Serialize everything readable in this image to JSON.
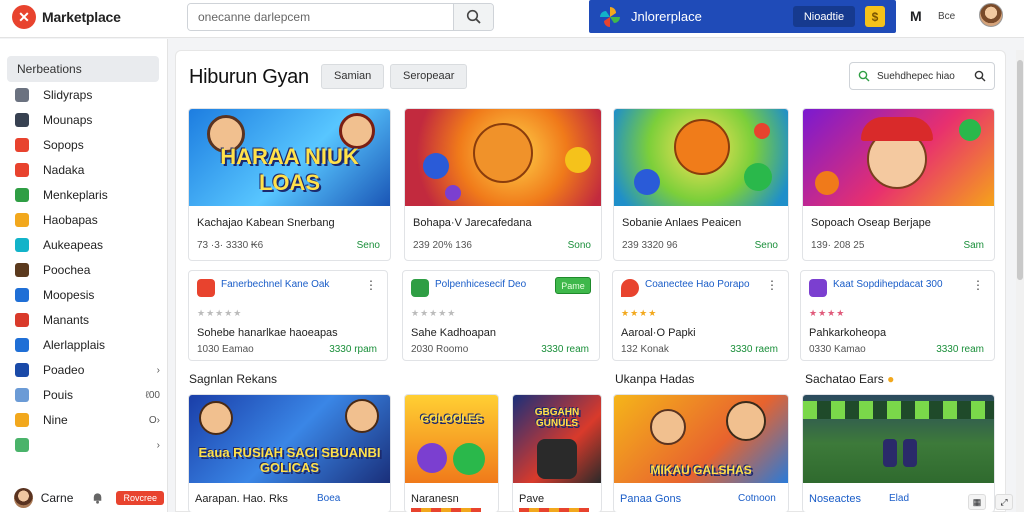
{
  "app": {
    "name": "Marketplace"
  },
  "search": {
    "placeholder": "onecanne darlepcem"
  },
  "promo": {
    "title": "Jnlorerplace",
    "button": "Nioadtie",
    "coin": "$"
  },
  "header": {
    "m_label": "M",
    "user_label": "Bce"
  },
  "sidebar": {
    "header": "Nerbeations",
    "items": [
      {
        "label": "Slidyraps",
        "icon_color": "#6b7280",
        "meta": ""
      },
      {
        "label": "Mounaps",
        "icon_color": "#374151",
        "meta": ""
      },
      {
        "label": "Sopops",
        "icon_color": "#e8432e",
        "meta": ""
      },
      {
        "label": "Nadaka",
        "icon_color": "#e8432e",
        "meta": ""
      },
      {
        "label": "Menkeplaris",
        "icon_color": "#2f9e44",
        "meta": ""
      },
      {
        "label": "Haobapas",
        "icon_color": "#f2a81d",
        "meta": ""
      },
      {
        "label": "Aukeapeas",
        "icon_color": "#12b3c9",
        "meta": ""
      },
      {
        "label": "Poochea",
        "icon_color": "#5b3a1e",
        "meta": ""
      },
      {
        "label": "Moopesis",
        "icon_color": "#1f6fd6",
        "meta": ""
      },
      {
        "label": "Manants",
        "icon_color": "#d93a2b",
        "meta": ""
      },
      {
        "label": "Alerlapplais",
        "icon_color": "#1f6fd6",
        "meta": ""
      },
      {
        "label": "Poadeo",
        "icon_color": "#1a4aa8",
        "meta": "›"
      },
      {
        "label": "Pouis",
        "icon_color": "#6b9bd6",
        "meta": "ℓ00"
      },
      {
        "label": "Nine",
        "icon_color": "#f2a81d",
        "meta": "O›"
      },
      {
        "label": "",
        "icon_color": "#4ab36a",
        "meta": "›"
      }
    ],
    "user": {
      "name": "Carne",
      "badge": "Rovcree"
    }
  },
  "main": {
    "title": "Hiburun Gyan",
    "filters": [
      "Samian",
      "Seropeaar"
    ],
    "search_label": "Suehdhepec hiao"
  },
  "featured": [
    {
      "art_text": "HARAA NIUK LOAS",
      "name": "Kachajao Kabean Snerbang",
      "meta": "73 ·3· 3330 ₭6",
      "price": "Seno"
    },
    {
      "art_text": "",
      "name": "Bohapa·V Jarecafedana",
      "meta": "239 20% 136",
      "price": "Sono"
    },
    {
      "art_text": "",
      "name": "Sobanie Anlaes Peaicen",
      "meta": "239 3320 96",
      "price": "Seno"
    },
    {
      "art_text": "",
      "name": "Sopoach Oseap Berjape",
      "meta": "139· 208 25",
      "price": "Sam"
    }
  ],
  "listings": [
    {
      "title": "Fanerbechnel Kane Oak",
      "stars": "★★★★★",
      "stars_grey": true,
      "desc": "Sohebe hanarlkae haoeapas",
      "meta": "1030 Eamao",
      "price": "3330 rpam",
      "button": ""
    },
    {
      "title": "Polpenhicesecif Deo",
      "stars": "★★★★★",
      "stars_grey": true,
      "desc": "Sahe Kadhoapan",
      "meta": "2030 Roomo",
      "price": "3330 ream",
      "button": "Pame"
    },
    {
      "title": "Coanectee Hao Porapo",
      "stars": "★★★★",
      "stars_grey": false,
      "desc": "Aaroal·O Papki",
      "meta": "132 Konak",
      "price": "3330 raem",
      "button": ""
    },
    {
      "title": "Kaat Sopdihepdacat 300",
      "stars": "★★★★",
      "stars_grey": false,
      "desc": "Pahkarkoheopa",
      "meta": "0330 Kamao",
      "price": "3330 ream",
      "button": ""
    }
  ],
  "sections": [
    "Sagnlan Rekans",
    "Ukanpa Hadas",
    "Sachatao Ears"
  ],
  "bottom": [
    {
      "art_text": "Eaua RUSIAH SACI SBUANBI GOLICAS",
      "name": "Aarapan. Hao. Rks",
      "sub": "Boea"
    },
    {
      "art_text": "GOLOOLES",
      "name": "Naranesn",
      "sub": ""
    },
    {
      "art_text": "GBGAHN GUNULS",
      "name": "Pave",
      "sub": ""
    },
    {
      "art_text": "MIKAU GALSHAS",
      "name": "Panaa Gons",
      "sub": "Cotnoon"
    },
    {
      "art_text": "",
      "name": "Noseactes",
      "sub": "Elad"
    }
  ]
}
